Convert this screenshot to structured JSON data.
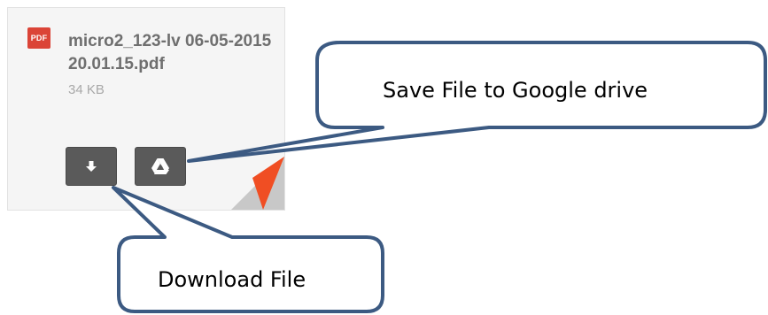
{
  "attachment": {
    "icon_label": "PDF",
    "file_name": "micro2_123-lv 06-05-2015 20.01.15.pdf",
    "file_size": "34 KB",
    "download_icon": "download-arrow-icon",
    "drive_icon": "google-drive-icon",
    "colors": {
      "pdf_red": "#db4437",
      "button_gray": "#5a5a5a",
      "corner_red": "#f04e23"
    }
  },
  "callouts": {
    "drive": "Save File to Google drive",
    "download": "Download File",
    "border_color": "#3c5a82"
  }
}
